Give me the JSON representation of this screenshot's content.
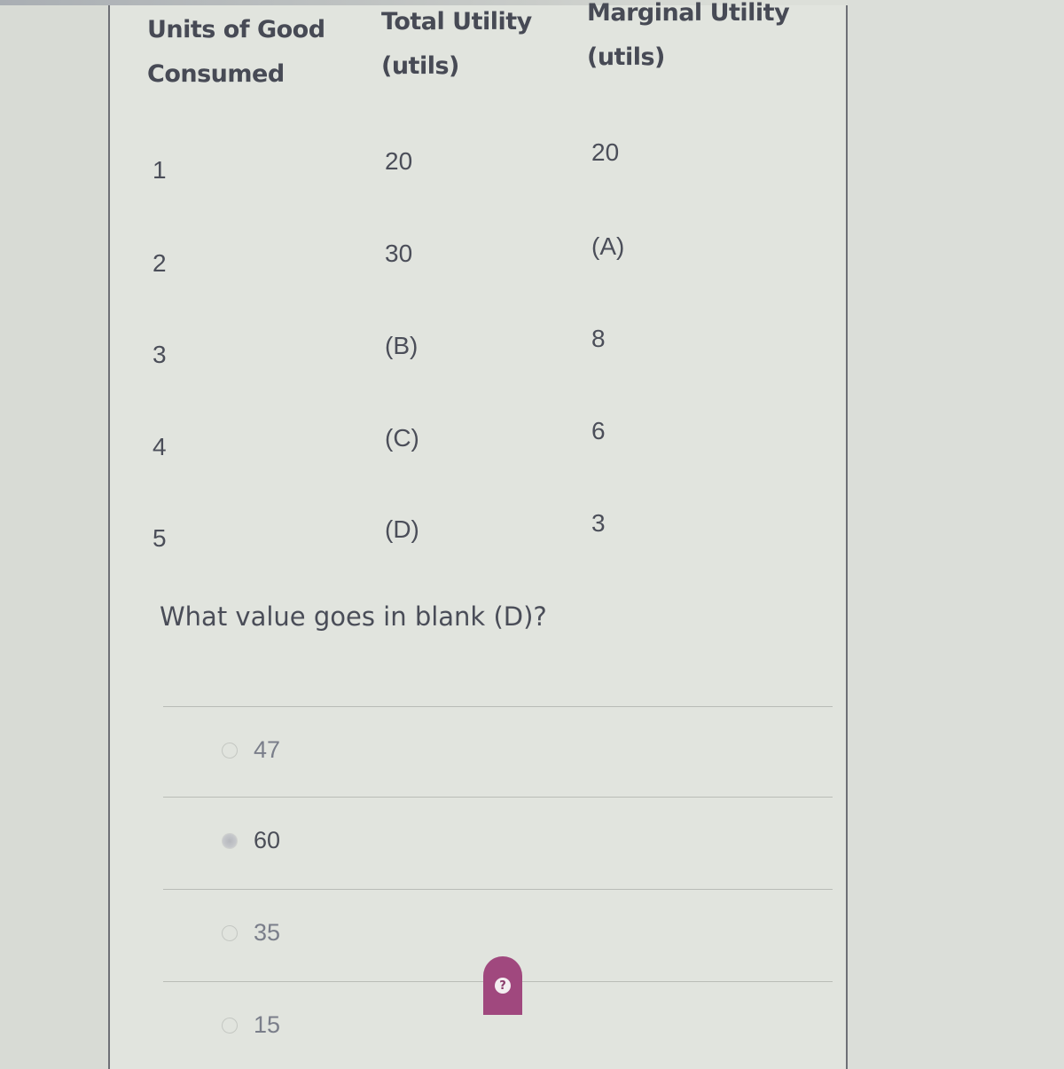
{
  "table": {
    "headers": [
      {
        "line1": "Units of Good",
        "line2": "Consumed"
      },
      {
        "line1": "Total Utility",
        "line2": "(utils)"
      },
      {
        "line1": "Marginal Utility",
        "line2": "(utils)"
      }
    ],
    "rows": [
      {
        "units": "1",
        "total": "20",
        "marginal": "20"
      },
      {
        "units": "2",
        "total": "30",
        "marginal": "(A)"
      },
      {
        "units": "3",
        "total": "(B)",
        "marginal": "8"
      },
      {
        "units": "4",
        "total": "(C)",
        "marginal": "6"
      },
      {
        "units": "5",
        "total": "(D)",
        "marginal": "3"
      }
    ]
  },
  "question": {
    "text": "What value goes in blank (D)?"
  },
  "options": [
    {
      "label": "47",
      "selected": false
    },
    {
      "label": "60",
      "selected": true
    },
    {
      "label": "35",
      "selected": false
    },
    {
      "label": "15",
      "selected": false
    }
  ],
  "help_button": {
    "icon": "question-mark-icon",
    "glyph": "?",
    "color": "#a0487e"
  }
}
